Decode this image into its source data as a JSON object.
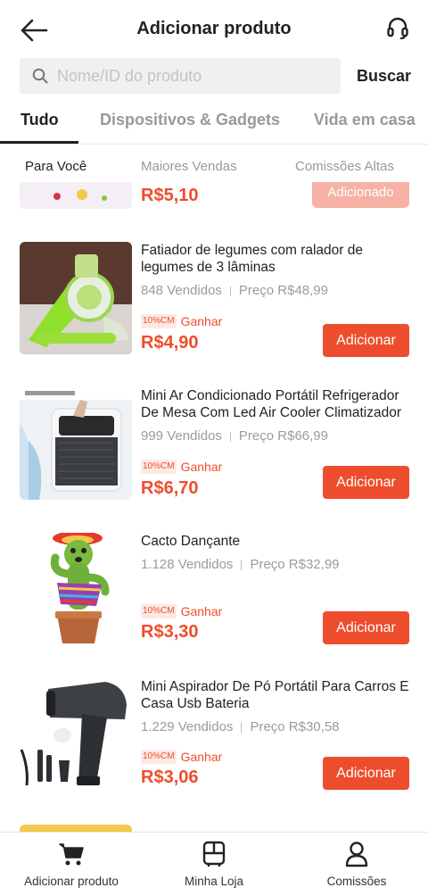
{
  "header": {
    "title": "Adicionar produto",
    "back_icon": "arrow-left-icon",
    "support_icon": "headset-icon"
  },
  "search": {
    "placeholder": "Nome/ID do produto",
    "value": "",
    "button_label": "Buscar"
  },
  "tabs": [
    "Tudo",
    "Dispositivos & Gadgets",
    "Vida em casa"
  ],
  "active_tab": "Tudo",
  "subtabs": [
    "Para Você",
    "Maiores Vendas",
    "Comissões Altas"
  ],
  "active_subtab": "Para Você",
  "partial_item": {
    "price": "R$5,10",
    "button_label": "Adicionado"
  },
  "products": [
    {
      "name": "Fatiador de legumes com ralador de legumes de 3 lâminas",
      "sold": "848 Vendidos",
      "price_label": "Preço R$48,99",
      "commission_badge": "10%CM",
      "commission_label": "Ganhar",
      "earn": "R$4,90",
      "button_label": "Adicionar"
    },
    {
      "name": "Mini Ar Condicionado Portátil Refrigerador De Mesa Com Led Air Cooler Climatizador",
      "sold": "999 Vendidos",
      "price_label": "Preço R$66,99",
      "commission_badge": "10%CM",
      "commission_label": "Ganhar",
      "earn": "R$6,70",
      "button_label": "Adicionar"
    },
    {
      "name": "Cacto Dançante",
      "sold": "1.128 Vendidos",
      "price_label": "Preço R$32,99",
      "commission_badge": "10%CM",
      "commission_label": "Ganhar",
      "earn": "R$3,30",
      "button_label": "Adicionar"
    },
    {
      "name": "Mini Aspirador De Pó Portátil Para Carros E Casa Usb Bateria",
      "sold": "1.229 Vendidos",
      "price_label": "Preço R$30,58",
      "commission_badge": "10%CM",
      "commission_label": "Ganhar",
      "earn": "R$3,06",
      "button_label": "Adicionar"
    }
  ],
  "bottom_nav": [
    {
      "label": "Adicionar produto",
      "icon": "cart-icon",
      "active": true
    },
    {
      "label": "Minha Loja",
      "icon": "store-icon",
      "active": false
    },
    {
      "label": "Comissões",
      "icon": "user-icon",
      "active": false
    }
  ],
  "colors": {
    "accent": "#ee4d2d",
    "accent_light": "#fde9e4",
    "muted_text": "#9b9b9b",
    "text": "#222222"
  }
}
